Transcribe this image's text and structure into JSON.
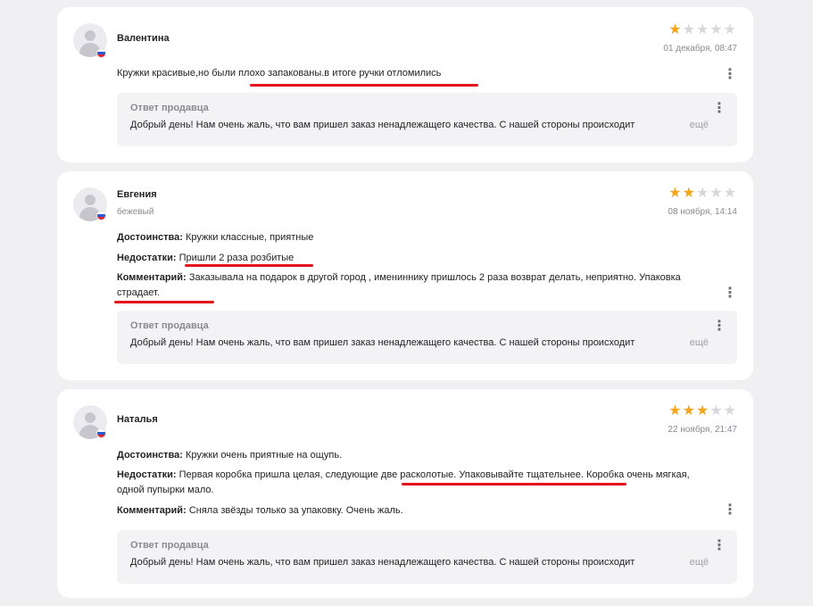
{
  "reviews": [
    {
      "author": "Валентина",
      "variant": "",
      "rating": 1,
      "date": "01 декабря, 08:47",
      "text": "Кружки красивые,но были плохо запакованы.в итоге ручки отломились",
      "reply_title": "Ответ продавца",
      "reply_text": "Добрый день! Нам очень жаль, что вам пришел заказ ненадлежащего качества. С нашей стороны происходит",
      "reply_more": "ещё"
    },
    {
      "author": "Евгения",
      "variant": "бежевый",
      "rating": 2,
      "date": "08 ноября, 14:14",
      "pros_label": "Достоинства:",
      "pros": "Кружки классные, приятные",
      "cons_label": "Недостатки:",
      "cons": "Пришли 2 раза розбитые",
      "comment_label": "Комментарий:",
      "comment": "Заказывала на подарок в другой город , имениннику пришлось 2 раза возврат делать, неприятно. Упаковка страдает.",
      "reply_title": "Ответ продавца",
      "reply_text": "Добрый день! Нам очень жаль, что вам пришел заказ ненадлежащего качества. С нашей стороны происходит",
      "reply_more": "ещё"
    },
    {
      "author": "Наталья",
      "variant": "",
      "rating": 3,
      "date": "22 ноября, 21:47",
      "pros_label": "Достоинства:",
      "pros": "Кружки очень приятные на ощупь.",
      "cons_label": "Недостатки:",
      "cons": "Первая коробка пришла целая, следующие две расколотые. Упаковывайте тщательнее. Коробка очень мягкая, одной пупырки мало.",
      "comment_label": "Комментарий:",
      "comment": "Сняла звёзды только за упаковку. Очень жаль.",
      "reply_title": "Ответ продавца",
      "reply_text": "Добрый день! Нам очень жаль, что вам пришел заказ ненадлежащего качества. С нашей стороны происходит",
      "reply_more": "ещё"
    }
  ],
  "colors": {
    "star_on": "#f4a51c",
    "star_off": "#d7d7dc",
    "highlight": "#e3121c"
  },
  "icons": {
    "avatar": "user-avatar-icon",
    "flag": "russia-flag-icon",
    "menu": "kebab-menu-icon",
    "star": "star-icon"
  }
}
